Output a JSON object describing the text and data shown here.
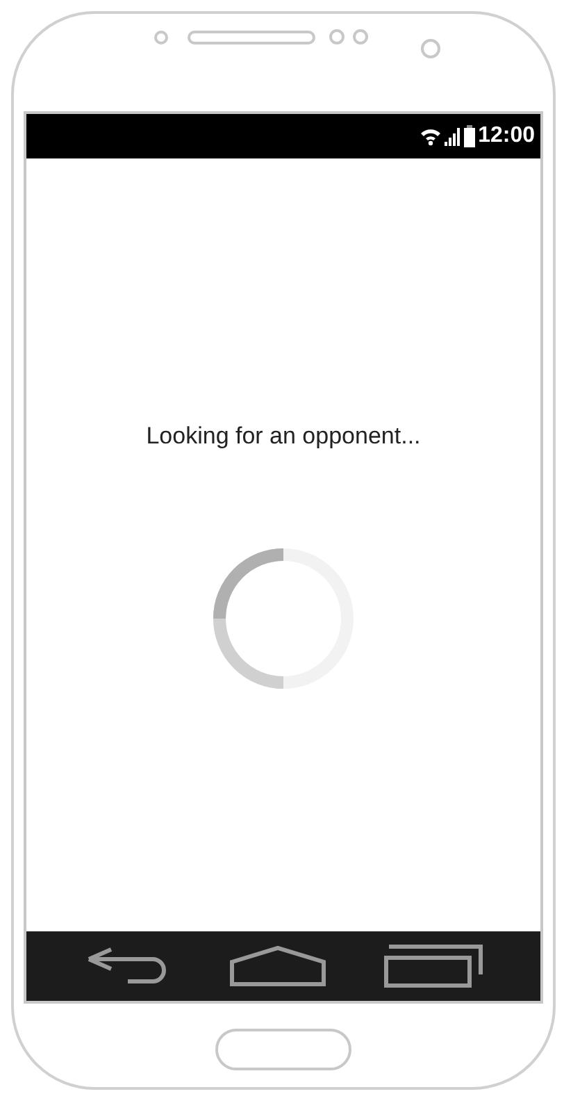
{
  "status_bar": {
    "time": "12:00"
  },
  "message": "Looking for an opponent..."
}
